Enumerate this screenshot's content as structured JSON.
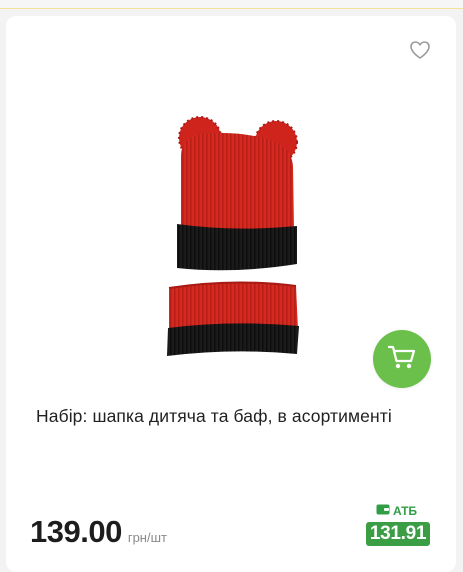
{
  "product": {
    "title": "Набір: шапка дитяча та баф, в асортименті",
    "image_icon": "knit-hat-and-snood-image",
    "favorite_icon": "heart-outline-icon",
    "cart_icon": "shopping-cart-icon"
  },
  "price": {
    "value": "139.00",
    "unit": "грн/шт"
  },
  "card_price": {
    "label": "АТБ",
    "icon": "wallet-card-icon",
    "value": "131.91"
  },
  "colors": {
    "accent_green": "#6bc04b",
    "card_price_green": "#3b9e45",
    "hat_red": "#d42a20",
    "hat_black": "#1b1b1b"
  }
}
